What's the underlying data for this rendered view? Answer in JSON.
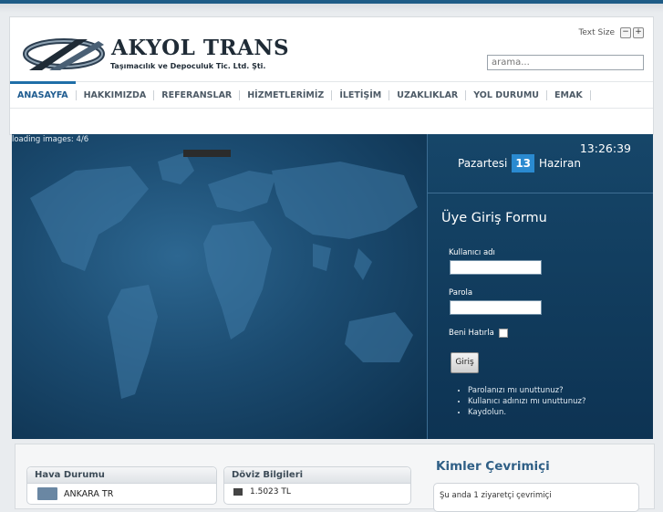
{
  "brand": {
    "name": "AKYOL TRANS",
    "tagline": "Taşımacılık ve Depoculuk Tic. Ltd. Şti."
  },
  "header": {
    "text_size_label": "Text Size",
    "decrease_label": "−",
    "increase_label": "+",
    "search_placeholder": "arama..."
  },
  "nav": {
    "items": [
      "ANASAYFA",
      "HAKKIMIZDA",
      "REFERANSLAR",
      "HİZMETLERİMİZ",
      "İLETİŞİM",
      "UZAKLIKLAR",
      "YOL DURUMU",
      "EMAK"
    ]
  },
  "slider": {
    "loading_text": "loading images: 4/6"
  },
  "datebox": {
    "clock": "13:26:39",
    "weekday": "Pazartesi",
    "day": "13",
    "month": "Haziran"
  },
  "login": {
    "title": "Üye Giriş Formu",
    "username_label": "Kullanıcı adı",
    "password_label": "Parola",
    "remember_label": "Beni Hatırla",
    "submit_label": "Giriş",
    "links": [
      "Parolanızı mı unuttunuz?",
      "Kullanıcı adınızı mı unuttunuz?",
      "Kaydolun."
    ]
  },
  "modules": {
    "weather_title": "Hava Durumu",
    "weather_city": "ANKARA TR",
    "currency_title": "Döviz Bilgileri",
    "currency_row": "1.5023 TL",
    "online_title": "Kimler Çevrimiçi",
    "online_text": "Şu anda 1 ziyaretçi çevrimiçi"
  },
  "colors": {
    "accent": "#1f6fa8",
    "panel_dark": "#0d3353",
    "date_highlight": "#2a8ad0"
  }
}
